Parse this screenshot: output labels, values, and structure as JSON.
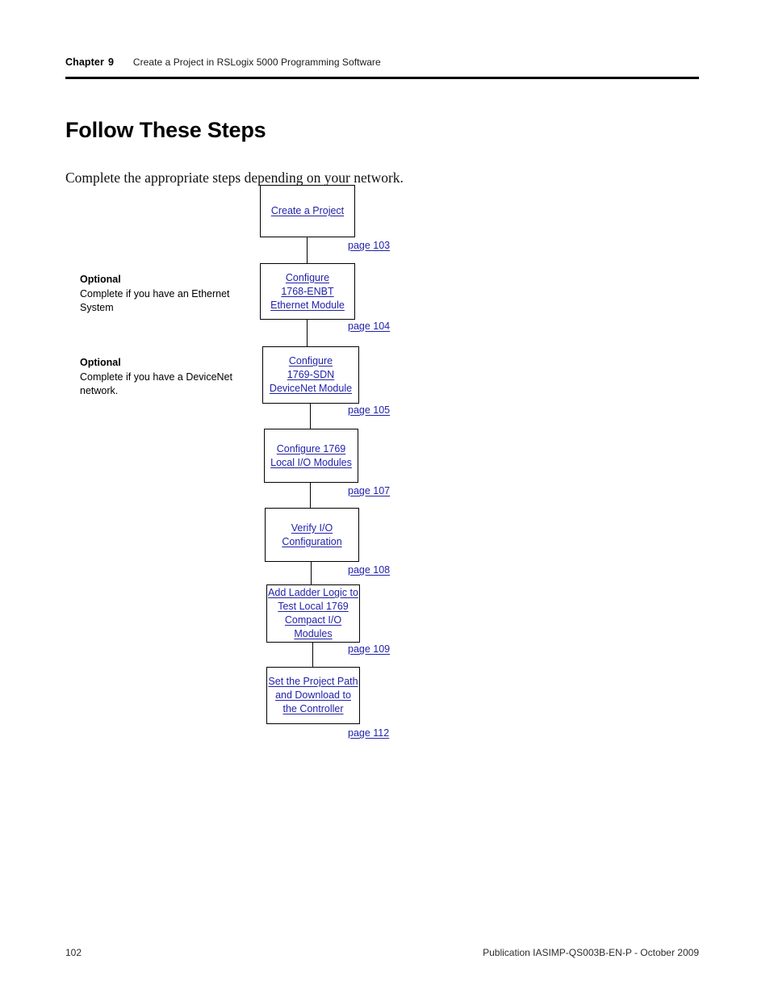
{
  "header": {
    "chapter_label": "Chapter",
    "chapter_number": "9",
    "title": "Create a Project in RSLogix 5000 Programming Software"
  },
  "page_title": "Follow These Steps",
  "intro_text": "Complete the appropriate steps depending on your network.",
  "colors": {
    "link": "#2222aa",
    "rule": "#000000",
    "text": "#000000"
  },
  "side_notes": [
    {
      "title": "Optional",
      "body": "Complete if you have an Ethernet System"
    },
    {
      "title": "Optional",
      "body": "Complete if you have a DeviceNet network."
    }
  ],
  "flow_steps": [
    {
      "label": "Create a Project",
      "page_ref": "page 103"
    },
    {
      "label": "Configure \n1768-ENBT \nEthernet Module",
      "page_ref": "page 104"
    },
    {
      "label": "Configure \n1769-SDN \nDeviceNet Module",
      "page_ref": "page 105"
    },
    {
      "label": "Configure 1769 \nLocal I/O Modules",
      "page_ref": "page 107"
    },
    {
      "label": "Verify I/O \nConfiguration",
      "page_ref": "page 108"
    },
    {
      "label": "Add Ladder Logic to \nTest Local 1769 \nCompact I/O \nModules",
      "page_ref": "page 109"
    },
    {
      "label": "Set the Project Path \nand Download to \nthe Controller",
      "page_ref": "page 112"
    }
  ],
  "footer": {
    "page_number": "102",
    "publication": "Publication IASIMP-QS003B-EN-P - October 2009"
  }
}
